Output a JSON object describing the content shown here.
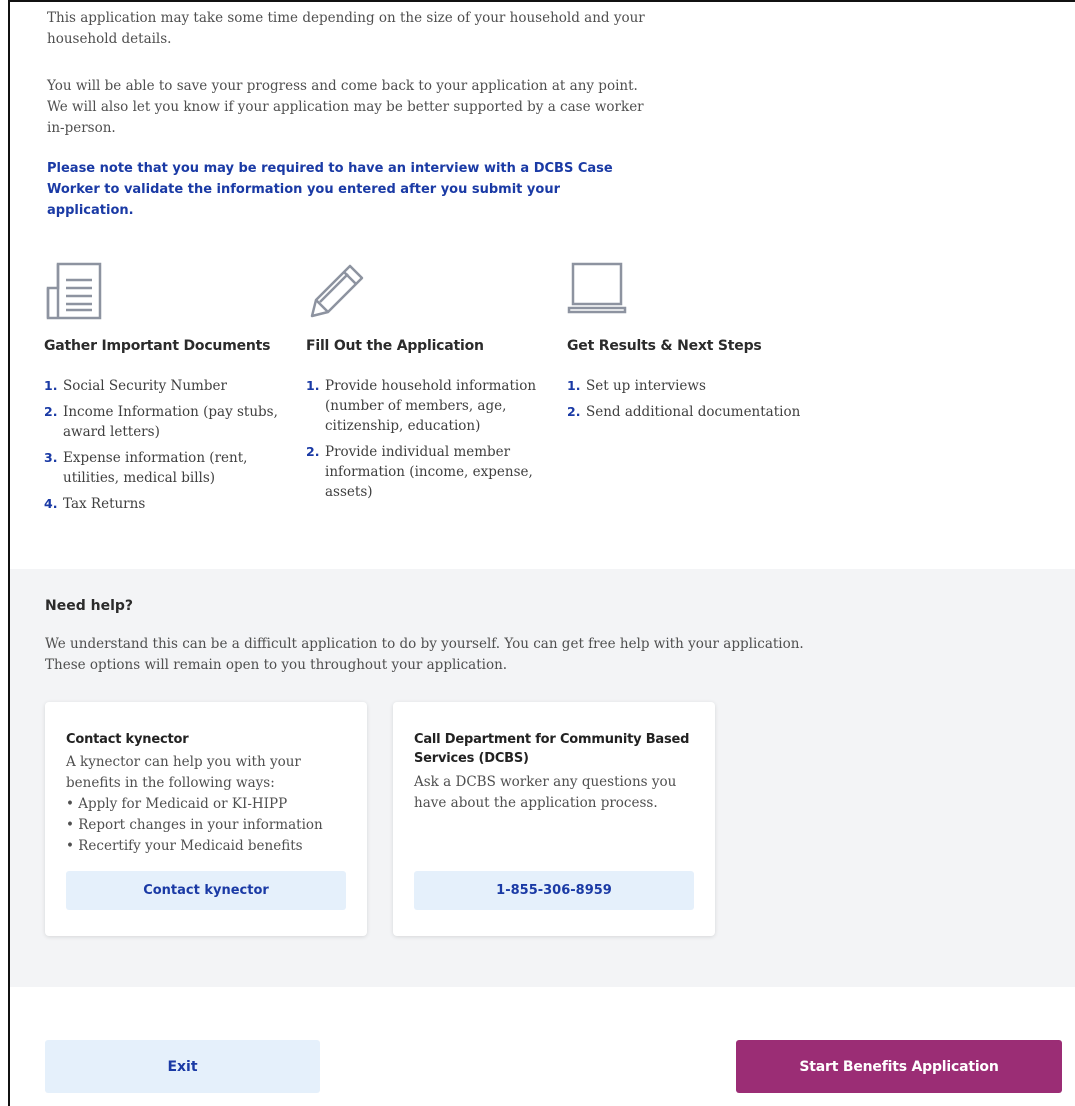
{
  "intro": {
    "para1": "This application may take some time depending on the size of your household and your household details.",
    "para2": "You will be able to save your progress and come back to your application at any point. We will also let you know if your application may be better supported by a case worker in-person.",
    "note": "Please note that you may be required to have an interview with a DCBS Case Worker to validate the information you entered after you submit your application."
  },
  "steps": [
    {
      "icon": "document-icon",
      "title": "Gather Important Documents",
      "items": [
        {
          "num": "1.",
          "text": "Social Security Number"
        },
        {
          "num": "2.",
          "text": "Income Information (pay stubs, award letters)"
        },
        {
          "num": "3.",
          "text": "Expense information (rent, utilities, medical bills)"
        },
        {
          "num": "4.",
          "text": "Tax Returns"
        }
      ]
    },
    {
      "icon": "pencil-icon",
      "title": "Fill Out the Application",
      "items": [
        {
          "num": "1.",
          "text": "Provide household information (number of members, age, citizenship, education)"
        },
        {
          "num": "2.",
          "text": "Provide individual member information (income, expense, assets)"
        }
      ]
    },
    {
      "icon": "laptop-icon",
      "title": "Get Results & Next Steps",
      "items": [
        {
          "num": "1.",
          "text": "Set up interviews"
        },
        {
          "num": "2.",
          "text": "Send additional documentation"
        }
      ]
    }
  ],
  "help": {
    "title": "Need help?",
    "text": "We understand this can be a difficult application to do by yourself. You can get free help with your application. These options will remain open to you throughout your application.",
    "cards": [
      {
        "title": "Contact kynector",
        "text": "A kynector can help you with your benefits in the following ways:",
        "bullets": [
          "Apply for Medicaid or KI-HIPP",
          "Report changes in your information",
          "Recertify your Medicaid benefits"
        ],
        "button": "Contact kynector"
      },
      {
        "title": "Call Department for Community Based Services (DCBS)",
        "text": "Ask a DCBS worker any questions you have about the application process.",
        "button": "1-855-306-8959"
      }
    ]
  },
  "footer": {
    "exit": "Exit",
    "start": "Start Benefits Application"
  },
  "colors": {
    "accent_blue": "#1a3aa5",
    "button_light": "#e5f0fb",
    "primary_button": "#9b2d75",
    "help_background": "#f3f4f6"
  }
}
